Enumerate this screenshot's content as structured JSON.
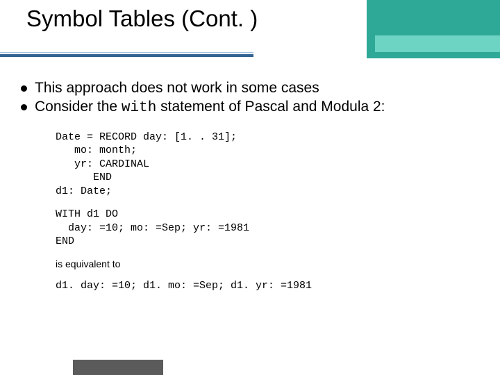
{
  "title": "Symbol Tables (Cont. )",
  "bullets": [
    {
      "pre": "This approach does not work in some cases",
      "code": "",
      "post": ""
    },
    {
      "pre": "Consider the ",
      "code": "with",
      "post": " statement of Pascal and Modula 2:"
    }
  ],
  "code1": "Date = RECORD day: [1. . 31];\n   mo: month;\n   yr: CARDINAL\n      END\nd1: Date;",
  "code2": "WITH d1 DO\n  day: =10; mo: =Sep; yr: =1981\nEND",
  "note": "is equivalent to",
  "code3": "d1. day: =10; d1. mo: =Sep; d1. yr: =1981"
}
